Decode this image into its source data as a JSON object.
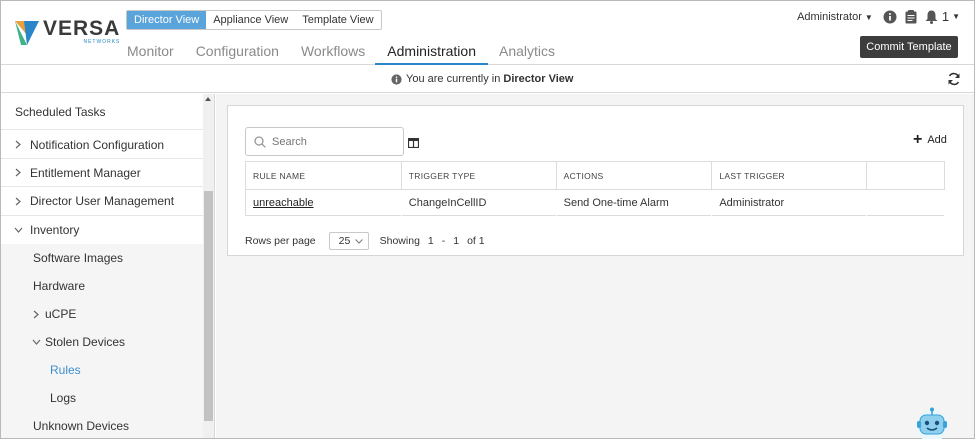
{
  "brand": {
    "name": "VERSA",
    "sub": "NETWORKS"
  },
  "view_switch": [
    "Director View",
    "Appliance View",
    "Template View"
  ],
  "nav_tabs": [
    "Monitor",
    "Configuration",
    "Workflows",
    "Administration",
    "Analytics"
  ],
  "active_nav": "Administration",
  "user": {
    "name": "Administrator",
    "notification_count": "1"
  },
  "commit_label": "Commit Template",
  "info_bar": {
    "prefix": "You are currently in",
    "view": "Director View"
  },
  "sidebar": {
    "items": [
      {
        "label": "Scheduled Tasks"
      },
      {
        "label": "Notification Configuration"
      },
      {
        "label": "Entitlement Manager"
      },
      {
        "label": "Director User Management"
      },
      {
        "label": "Inventory"
      },
      {
        "label": "Software Images"
      },
      {
        "label": "Hardware"
      },
      {
        "label": "uCPE"
      },
      {
        "label": "Stolen Devices"
      },
      {
        "label": "Rules"
      },
      {
        "label": "Logs"
      },
      {
        "label": "Unknown Devices"
      }
    ]
  },
  "search": {
    "placeholder": "Search"
  },
  "add_label": "Add",
  "table": {
    "columns": [
      "RULE NAME",
      "TRIGGER TYPE",
      "ACTIONS",
      "LAST TRIGGER",
      ""
    ],
    "rows": [
      [
        "unreachable",
        "ChangeInCellID",
        "Send One-time Alarm",
        "Administrator",
        ""
      ]
    ]
  },
  "pager": {
    "rows_label": "Rows per page",
    "rows_value": "25",
    "showing_label": "Showing",
    "from": "1",
    "to": "1",
    "total": "of 1"
  },
  "colors": {
    "accent": "#2a86c8",
    "active_view": "#5aa4dc",
    "commit_bg": "#3d3d3d",
    "link_active": "#3d8fd1"
  }
}
